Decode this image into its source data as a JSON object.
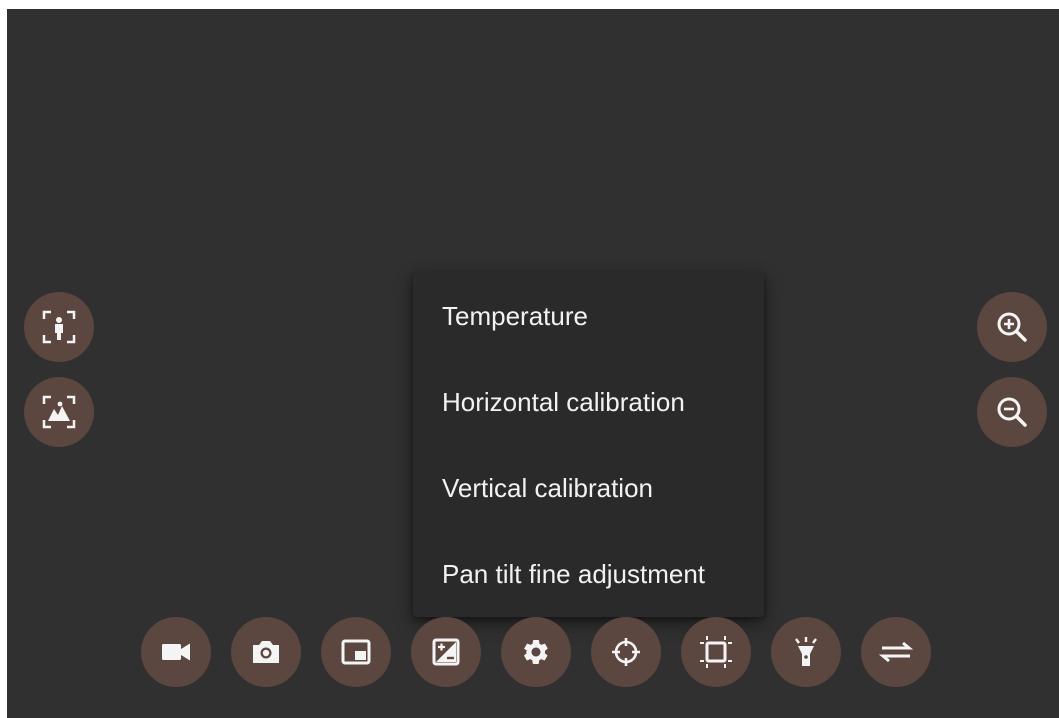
{
  "menu": {
    "items": [
      {
        "label": "Temperature"
      },
      {
        "label": "Horizontal calibration"
      },
      {
        "label": "Vertical calibration"
      },
      {
        "label": "Pan tilt fine adjustment"
      }
    ]
  },
  "left_controls": [
    {
      "icon": "portrait-frame-icon"
    },
    {
      "icon": "landscape-frame-icon"
    }
  ],
  "right_controls": [
    {
      "icon": "zoom-in-icon"
    },
    {
      "icon": "zoom-out-icon"
    }
  ],
  "bottom_toolbar": [
    {
      "icon": "video-camera-icon"
    },
    {
      "icon": "camera-icon"
    },
    {
      "icon": "picture-in-picture-icon"
    },
    {
      "icon": "exposure-icon"
    },
    {
      "icon": "gear-icon"
    },
    {
      "icon": "crosshair-icon"
    },
    {
      "icon": "crop-frame-icon"
    },
    {
      "icon": "flashlight-icon"
    },
    {
      "icon": "swap-arrows-icon"
    }
  ],
  "colors": {
    "background": "#303030",
    "button": "#5b4640",
    "menu": "#2a2a2a",
    "menu_text": "#f2f2f2",
    "icon": "#f4f4f4"
  }
}
